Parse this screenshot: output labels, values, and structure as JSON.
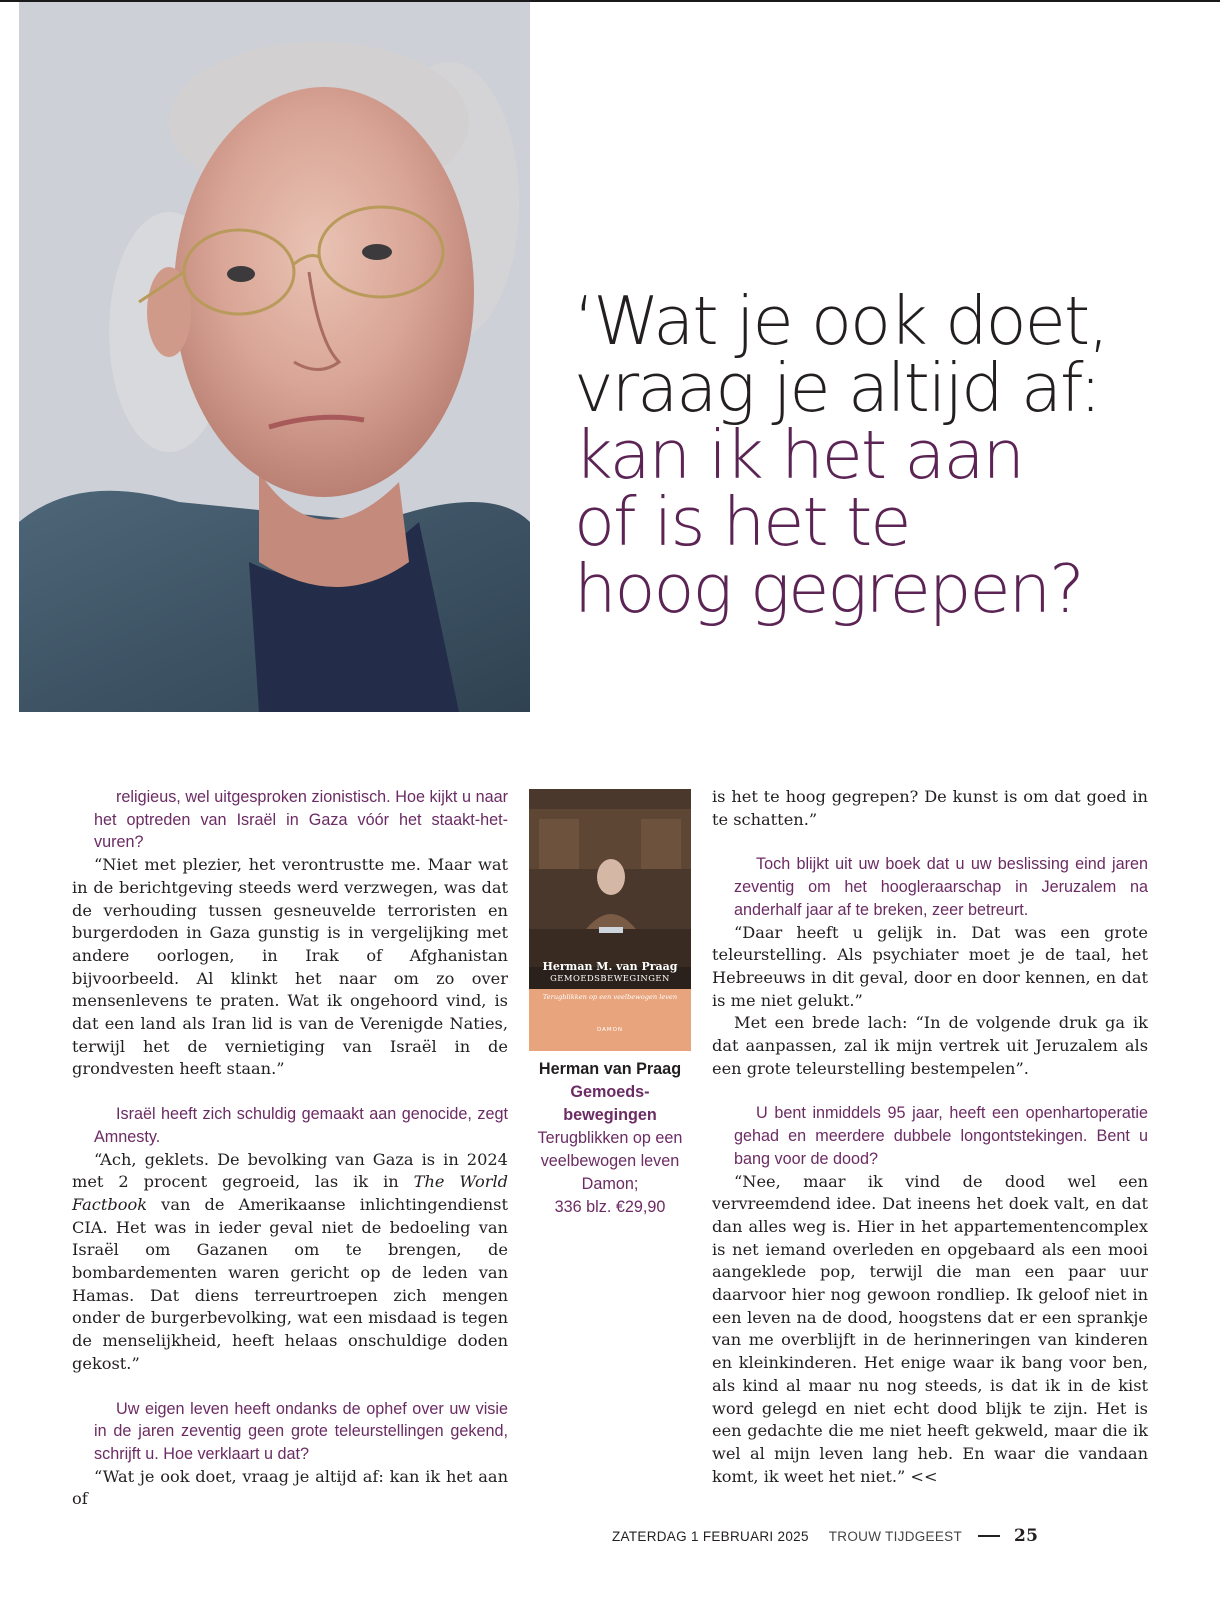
{
  "pullquote": {
    "line1": "‘Wat je ook doet,",
    "line2": "vraag je altijd af:",
    "line3": "kan ik het aan",
    "line4": "of is het te",
    "line5": "hoog gegrepen?"
  },
  "col1": {
    "q1": "religieus, wel uitgesproken zionistisch. Hoe kijkt u naar het optreden van Israël in Gaza vóór het staakt-het-vuren?",
    "a1": "“Niet met plezier, het verontrustte me. Maar wat in de berichtgeving steeds werd verzwegen, was dat de verhouding tussen gesneuvelde terroristen en burgerdoden in Gaza gunstig is in vergelijking met andere oorlogen, in Irak of Afghanistan bijvoorbeeld. Al klinkt het naar om zo over mensenlevens te praten. Wat ik ongehoord vind, is dat een land als Iran lid is van de Verenigde Naties, terwijl het de vernietiging van Israël in de grondvesten heeft staan.”",
    "q2": "Israël heeft zich schuldig gemaakt aan genocide, zegt Amnesty.",
    "a2_before": "“Ach, geklets. De bevolking van Gaza is in 2024 met 2 procent gegroeid, las ik in ",
    "a2_italic": "The World Factbook",
    "a2_after": " van de Amerikaanse inlichtingendienst CIA. Het was in ieder geval niet de bedoeling van Israël om Gazanen om te brengen, de bombardementen waren gericht op de leden van Hamas. Dat diens terreurtroepen zich mengen onder de burgerbevolking, wat een misdaad is tegen de menselijkheid, heeft helaas onschuldige doden gekost.”",
    "q3": "Uw eigen leven heeft ondanks de ophef over uw visie in de jaren zeventig geen grote teleurstellingen gekend, schrijft u. Hoe verklaart u dat?",
    "a3": "“Wat je ook doet, vraag je altijd af: kan ik het aan of"
  },
  "book": {
    "cover_author": "Herman M. van Praag",
    "cover_title": "GEMOEDSBEWEGINGEN",
    "cover_tagline": "Terugblikken op een veelbewogen leven",
    "cover_publisher": "DAMON",
    "author": "Herman van Praag",
    "title_line1": "Gemoeds-",
    "title_line2": "bewegingen",
    "subtitle_line1": "Terugblikken op een",
    "subtitle_line2": "veelbewogen leven",
    "publisher": "Damon;",
    "price": "336 blz. €29,90"
  },
  "col3": {
    "a0": "is het te hoog gegrepen? De kunst is om dat goed in te schatten.”",
    "q1": "Toch blijkt uit uw boek dat u uw beslissing eind jaren zeventig om het hoogleraarschap in Jeruzalem na anderhalf jaar af te breken, zeer betreurt.",
    "a1": "“Daar heeft u gelijk in. Dat was een grote teleurstelling. Als psychiater moet je de taal, het Hebreeuws in dit geval, door en door kennen, en dat is me niet gelukt.”",
    "a1b": "Met een brede lach: “In de volgende druk ga ik dat aanpassen, zal ik mijn vertrek uit Jeruzalem als een grote teleurstelling bestempelen”.",
    "q2": "U bent inmiddels 95 jaar, heeft een openhartoperatie gehad en meerdere dubbele longontstekingen. Bent u bang voor de dood?",
    "a2": "“Nee, maar ik vind de dood wel een vervreemdend idee. Dat ineens het doek valt, en dat dan alles weg is. Hier in het appartementencomplex is net iemand overleden en opgebaard als een mooi aangeklede pop, terwijl die man een paar uur daarvoor hier nog gewoon rondliep. Ik geloof niet in een leven na de dood, hoogstens dat er een sprankje van me overblijft in de herinneringen van kinderen en kleinkinderen. Het enige waar ik bang voor ben, als kind al maar nu nog steeds, is dat ik in de kist word gelegd en niet echt dood blijk te zijn. Het is een gedachte die me niet heeft gekweld, maar die ik wel al mijn leven lang heb. En waar die vandaan komt, ik weet het niet.” <<"
  },
  "footer": {
    "date": "ZATERDAG 1 FEBRUARI 2025",
    "section": "TROUW TIJDGEEST",
    "page": "25"
  },
  "colors": {
    "accent": "#6b2b63",
    "headline_purple": "#5b2454",
    "text": "#231f20"
  }
}
